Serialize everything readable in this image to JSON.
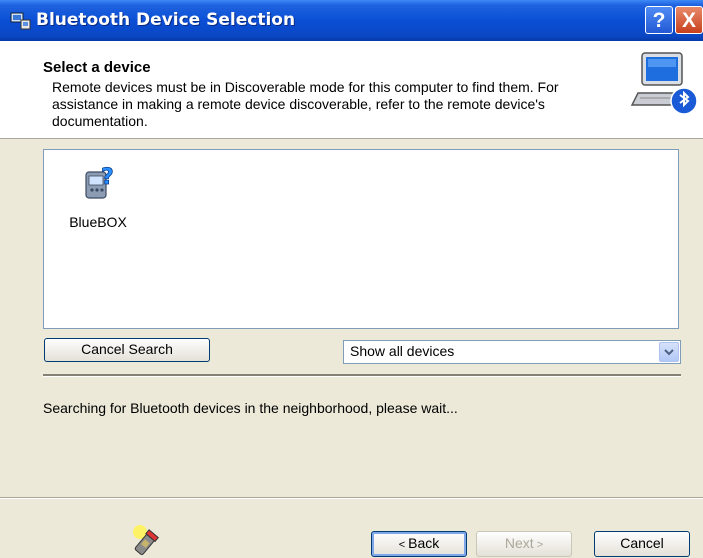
{
  "window": {
    "title": "Bluetooth Device Selection",
    "help_button": "?",
    "close_button": "X"
  },
  "header": {
    "title": "Select a device",
    "description": "Remote devices must be in Discoverable mode for this computer to find them. For assistance in making a remote device discoverable, refer to the remote device's documentation."
  },
  "devices": [
    {
      "label": "BlueBOX",
      "icon": "device-question-icon"
    }
  ],
  "controls": {
    "cancel_search": "Cancel Search",
    "filter_selected": "Show all devices"
  },
  "status": "Searching for Bluetooth devices in the neighborhood, please wait...",
  "footer": {
    "back": "Back",
    "next": "Next",
    "cancel": "Cancel"
  },
  "colors": {
    "titlebar": "#0b4fd6",
    "dialog_bg": "#ece9d8",
    "list_border": "#7f9db9"
  }
}
